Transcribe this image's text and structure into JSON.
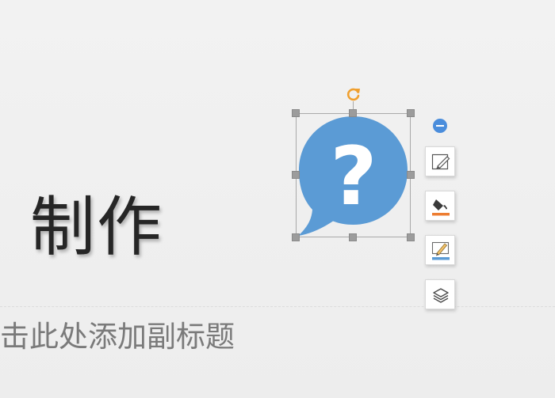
{
  "slide": {
    "title": "制作",
    "subtitle_placeholder": "击此处添加副标题"
  },
  "shape": {
    "icon": "question-speech-bubble-icon",
    "fill_color": "#5b9bd5",
    "glyph": "?"
  },
  "side_toolbar": {
    "collapse_icon": "minus-circle-icon",
    "buttons": [
      {
        "icon": "style-icon"
      },
      {
        "icon": "fill-bucket-icon"
      },
      {
        "icon": "outline-pen-icon"
      },
      {
        "icon": "layers-icon"
      }
    ]
  },
  "colors": {
    "selection_handle": "#9c9c9c",
    "rotate_handle": "#f0a030",
    "fill_underline": "#ed7d31",
    "outline_underline": "#5b9bd5",
    "accent_blue": "#4a8ddc"
  }
}
